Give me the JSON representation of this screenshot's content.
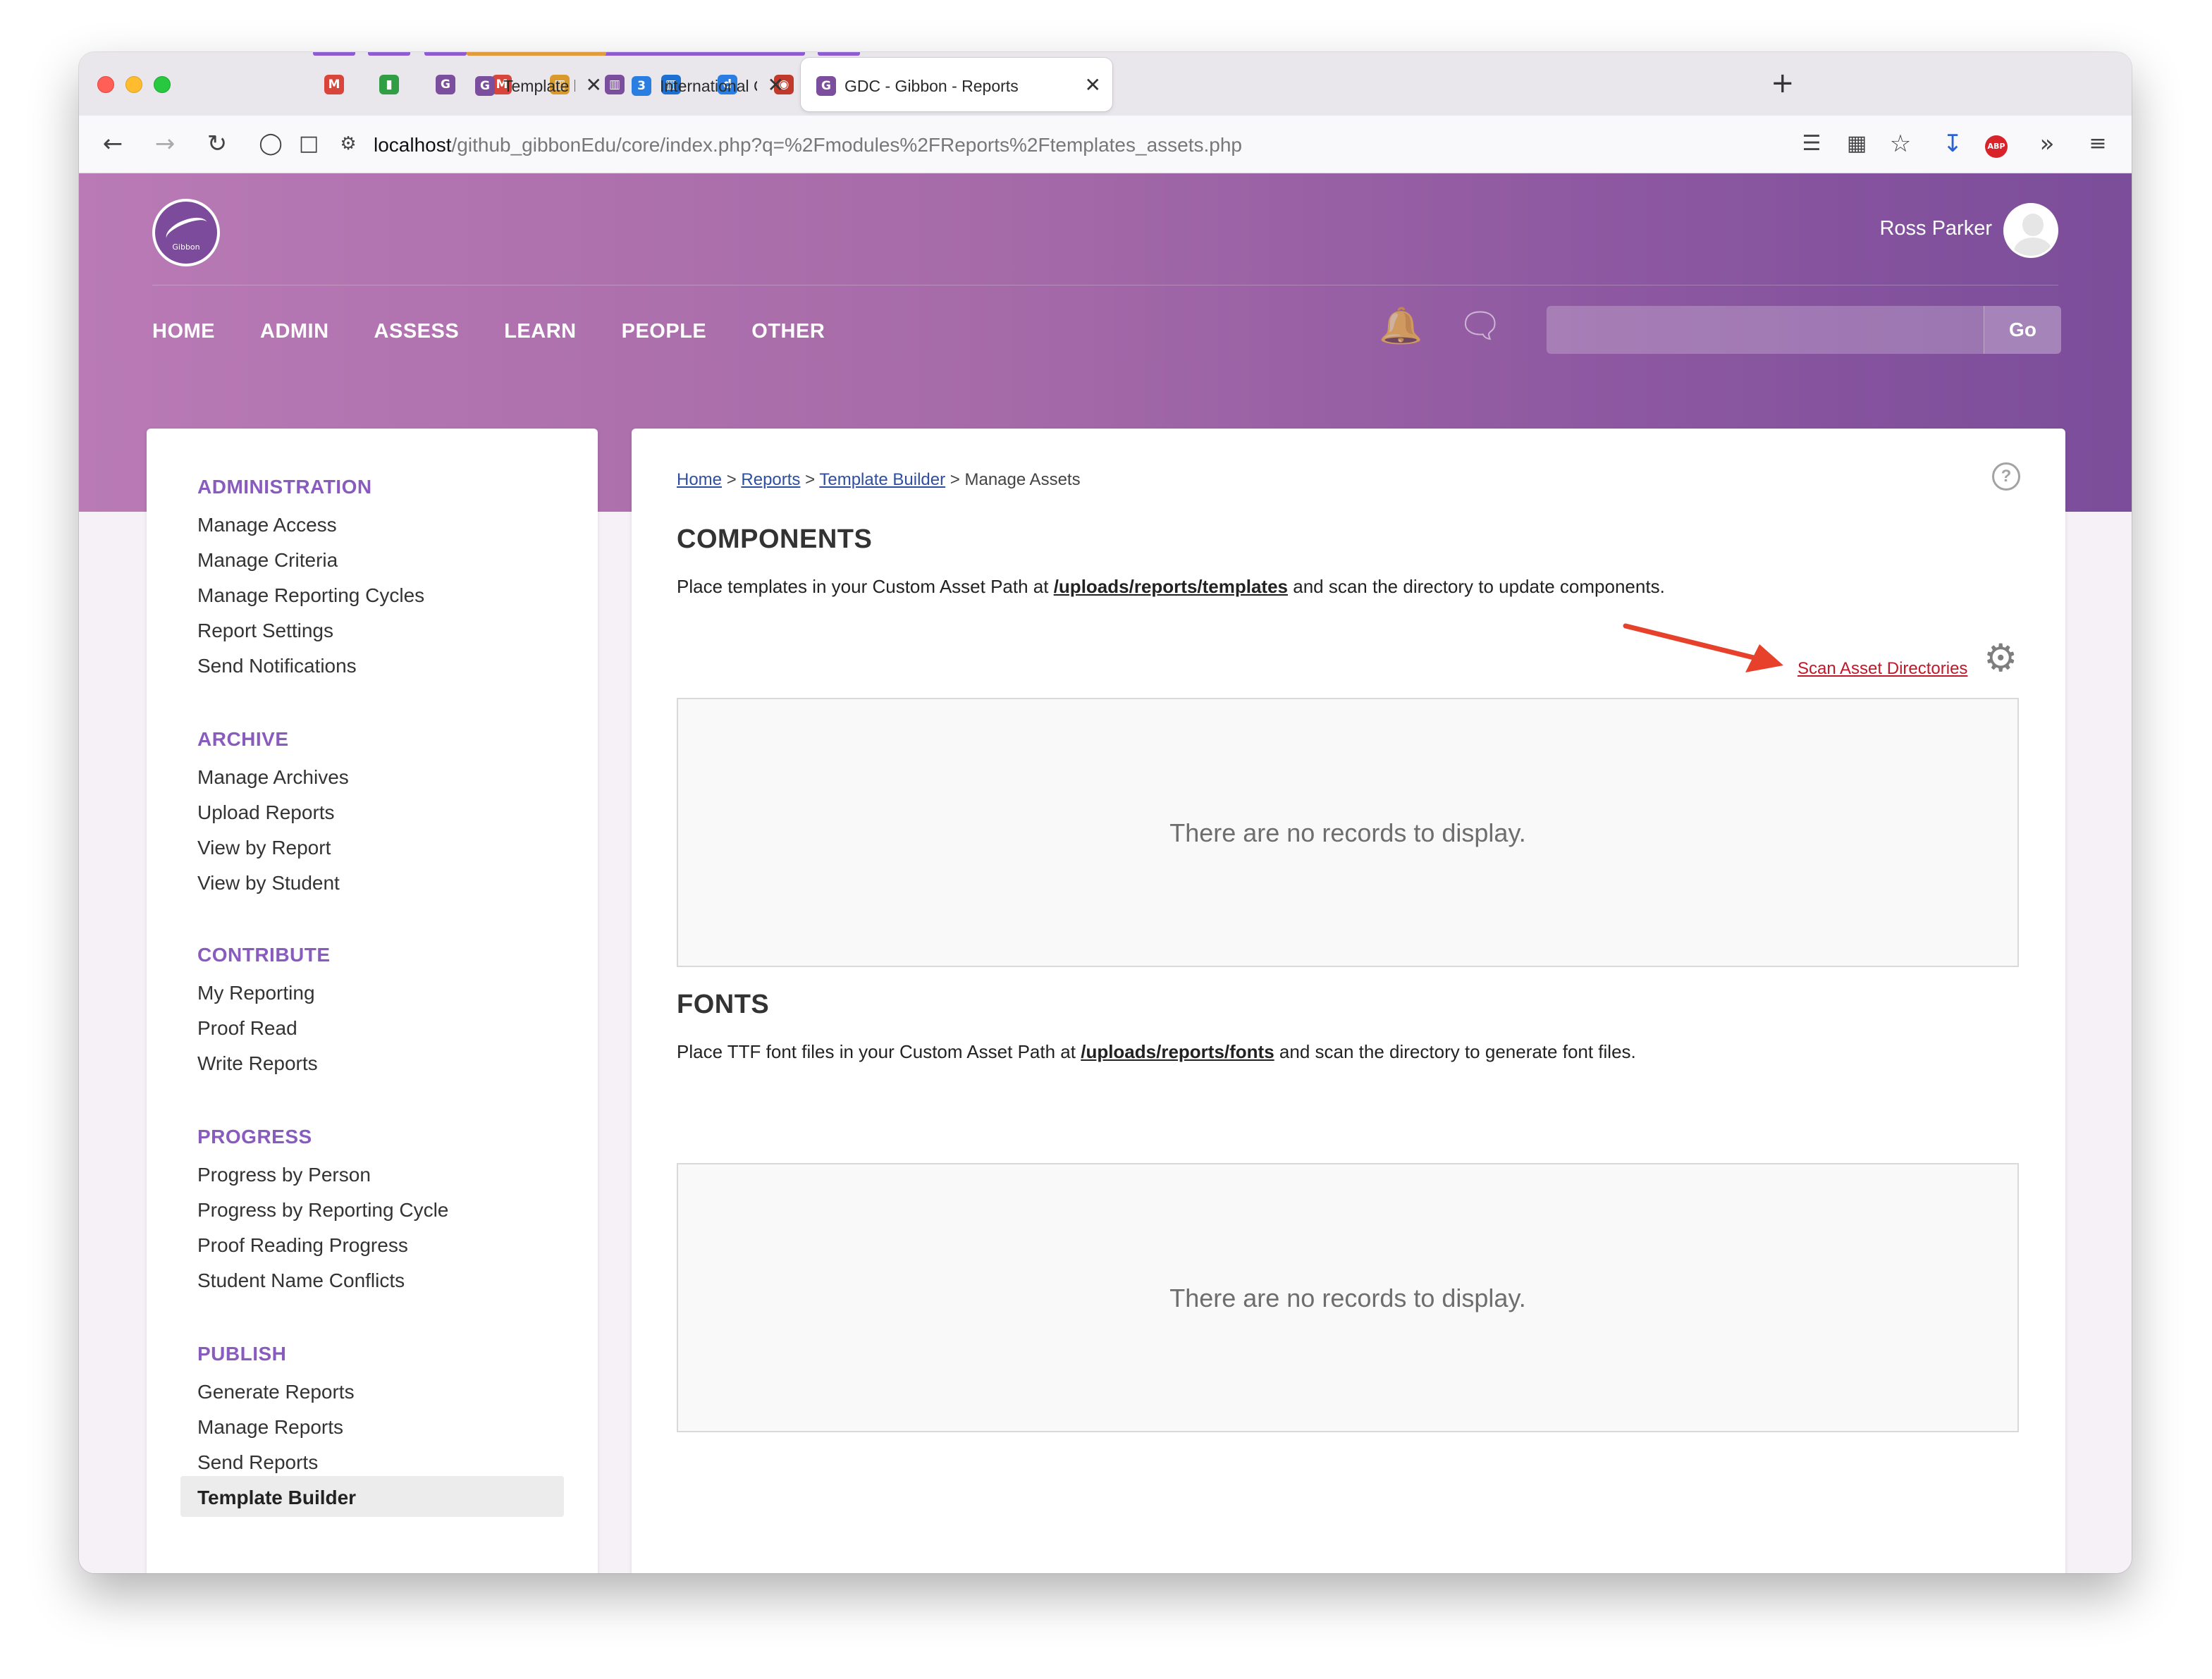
{
  "browser": {
    "pinned_tabs": [
      {
        "icon": "gmail-icon",
        "glyph": "M",
        "color": "#d9453a",
        "bar": "#8e5bd0"
      },
      {
        "icon": "chat-icon",
        "glyph": "▮",
        "color": "#2f9e44",
        "bar": "#8e5bd0"
      },
      {
        "icon": "gibbon-icon",
        "glyph": "G",
        "color": "#7c4e9e",
        "bar": "#8e5bd0"
      },
      {
        "icon": "gmail-icon",
        "glyph": "M",
        "color": "#d9453a",
        "bar": "#e39a3a"
      },
      {
        "icon": "trello-icon",
        "glyph": "▥",
        "color": "#d99a2b",
        "bar": "#e39a3a"
      },
      {
        "icon": "trello-icon",
        "glyph": "▥",
        "color": "#7c4e9e",
        "bar": "#8e5bd0"
      },
      {
        "icon": "trello-icon",
        "glyph": "▥",
        "color": "#1d6fd1",
        "bar": "#8e5bd0"
      },
      {
        "icon": "docs-icon",
        "glyph": "d",
        "color": "#2a7de1",
        "bar": "#8e5bd0"
      },
      {
        "icon": "camera-icon",
        "glyph": "◉",
        "color": "#c0392b",
        "bar": "#8e5bd0"
      },
      {
        "icon": "whatsapp-icon",
        "glyph": "✆",
        "color": "#25a745",
        "bar": "#8e5bd0"
      }
    ],
    "tabs": [
      {
        "title": "Template builder show no core c",
        "close": "✕",
        "favicon": "G",
        "bar": "#e39a3a"
      },
      {
        "title": "International College Hong Kong",
        "close": "✕",
        "favicon": "3",
        "bar": "#8e5bd0"
      },
      {
        "title": "GDC - Gibbon - Reports",
        "close": "✕",
        "favicon": "G",
        "bar": ""
      }
    ],
    "new_tab": "+",
    "url_host": "localhost",
    "url_path": "/github_gibbonEdu/core/index.php?q=%2Fmodules%2FReports%2Ftemplates_assets.php",
    "abp_label": "ABP"
  },
  "header": {
    "logo_text": "Gibbon",
    "user_name": "Ross Parker",
    "menu": [
      "HOME",
      "ADMIN",
      "ASSESS",
      "LEARN",
      "PEOPLE",
      "OTHER"
    ],
    "search_button": "Go"
  },
  "sidebar": {
    "sections": [
      {
        "title": "ADMINISTRATION",
        "items": [
          "Manage Access",
          "Manage Criteria",
          "Manage Reporting Cycles",
          "Report Settings",
          "Send Notifications"
        ]
      },
      {
        "title": "ARCHIVE",
        "items": [
          "Manage Archives",
          "Upload Reports",
          "View by Report",
          "View by Student"
        ]
      },
      {
        "title": "CONTRIBUTE",
        "items": [
          "My Reporting",
          "Proof Read",
          "Write Reports"
        ]
      },
      {
        "title": "PROGRESS",
        "items": [
          "Progress by Person",
          "Progress by Reporting Cycle",
          "Proof Reading Progress",
          "Student Name Conflicts"
        ]
      },
      {
        "title": "PUBLISH",
        "items": [
          "Generate Reports",
          "Manage Reports",
          "Send Reports",
          "Template Builder"
        ]
      }
    ],
    "active_item": "Template Builder"
  },
  "breadcrumb": {
    "home": "Home",
    "reports": "Reports",
    "template_builder": "Template Builder",
    "current": "Manage Assets",
    "sep": ">"
  },
  "components": {
    "title": "COMPONENTS",
    "desc_before": "Place templates in your Custom Asset Path at ",
    "path": "/uploads/reports/templates",
    "desc_after": " and scan the directory to update components.",
    "scan_link": "Scan Asset Directories",
    "empty": "There are no records to display."
  },
  "fonts": {
    "title": "FONTS",
    "desc_before": "Place TTF font files in your Custom Asset Path at ",
    "path": "/uploads/reports/fonts",
    "desc_after": " and scan the directory to generate font files.",
    "empty": "There are no records to display."
  },
  "help_glyph": "?",
  "colors": {
    "accent": "#8a5bbf",
    "header_start": "#b97ab5",
    "header_end": "#7b4d9a",
    "link": "#2f4ea0",
    "scan_link": "#c0182a",
    "annotation_arrow": "#e8412b"
  }
}
